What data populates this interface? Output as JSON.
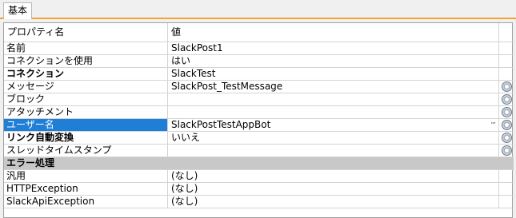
{
  "tabs": [
    {
      "label": "基本"
    }
  ],
  "header": {
    "name_label": "プロパティ名",
    "value_label": "値"
  },
  "rows": [
    {
      "name": "名前",
      "value": "SlackPost1",
      "bold": false,
      "action": ""
    },
    {
      "name": "コネクションを使用",
      "value": "はい",
      "bold": false,
      "action": ""
    },
    {
      "name": "コネクション",
      "value": "SlackTest",
      "bold": true,
      "action": ""
    },
    {
      "name": "メッセージ",
      "value": "SlackPost_TestMessage",
      "bold": false,
      "action": "gear"
    },
    {
      "name": "ブロック",
      "value": "",
      "bold": false,
      "action": "gear"
    },
    {
      "name": "アタッチメント",
      "value": "",
      "bold": false,
      "action": "gear"
    },
    {
      "name": "ユーザー名",
      "value": "SlackPostTestAppBot",
      "bold": false,
      "action": "gear",
      "selected": true,
      "ellipsis": "···"
    },
    {
      "name": "リンク自動変換",
      "value": "いいえ",
      "bold": true,
      "action": "gear"
    },
    {
      "name": "スレッドタイムスタンプ",
      "value": "",
      "bold": false,
      "action": "gear"
    },
    {
      "name": "エラー処理",
      "value": "",
      "bold": true,
      "category": true,
      "action": ""
    },
    {
      "name": "汎用",
      "value": "(なし)",
      "bold": false,
      "action": ""
    },
    {
      "name": "HTTPException",
      "value": "(なし)",
      "bold": false,
      "action": ""
    },
    {
      "name": "SlackApiException",
      "value": "(なし)",
      "bold": false,
      "action": ""
    }
  ],
  "icons": {
    "gear": "gear-icon",
    "ellipsis": "ellipsis-button"
  },
  "colors": {
    "selected_bg": "#1f7ed6",
    "category_bg": "#c8c8c8",
    "tab_underline": "#f2a33a"
  }
}
